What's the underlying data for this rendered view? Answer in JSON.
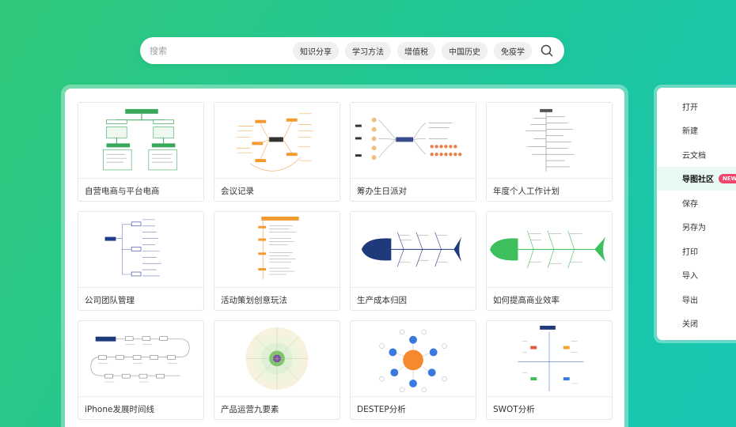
{
  "search": {
    "placeholder": "搜索",
    "tags": [
      "知识分享",
      "学习方法",
      "增值税",
      "中国历史",
      "免疫学"
    ]
  },
  "templates": [
    {
      "title": "自营电商与平台电商",
      "thumb": "org-chart"
    },
    {
      "title": "会议记录",
      "thumb": "mindmap-orange"
    },
    {
      "title": "筹办生日派对",
      "thumb": "mindmap-party"
    },
    {
      "title": "年度个人工作计划",
      "thumb": "tree-list"
    },
    {
      "title": "公司团队管理",
      "thumb": "tree-blue"
    },
    {
      "title": "活动策划创意玩法",
      "thumb": "list-orange"
    },
    {
      "title": "生产成本归因",
      "thumb": "fishbone-navy"
    },
    {
      "title": "如何提高商业效率",
      "thumb": "fishbone-green"
    },
    {
      "title": "iPhone发展时间线",
      "thumb": "timeline"
    },
    {
      "title": "产品运营九要素",
      "thumb": "radial"
    },
    {
      "title": "DESTEP分析",
      "thumb": "bubble"
    },
    {
      "title": "SWOT分析",
      "thumb": "swot"
    }
  ],
  "menu": {
    "items": [
      {
        "label": "打开"
      },
      {
        "label": "新建"
      },
      {
        "label": "云文档"
      },
      {
        "label": "导图社区",
        "badge": "NEW",
        "active": true
      },
      {
        "label": "保存"
      },
      {
        "label": "另存为"
      },
      {
        "label": "打印"
      },
      {
        "label": "导入"
      },
      {
        "label": "导出"
      },
      {
        "label": "关闭"
      }
    ]
  },
  "colors": {
    "accent": "#1fc69a",
    "badge": "#f0466b",
    "active_bg": "#e8faf3"
  }
}
